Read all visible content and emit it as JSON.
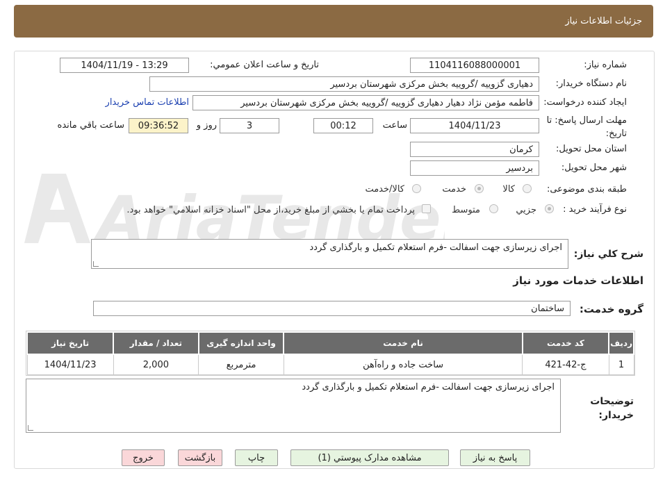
{
  "header": {
    "title": "جزئیات اطلاعات نیاز"
  },
  "watermark": {
    "text": "AriaTender.neT"
  },
  "fields": {
    "need_number_label": "شماره نیاز:",
    "need_number": "1104116088000001",
    "announce_label": "تاریخ و ساعت اعلان عمومي:",
    "announce_value": "1404/11/19 - 13:29",
    "buyer_org_label": "نام دستگاه خريدار:",
    "buyer_org": "دهیاری گزوییه /گروییه بخش مرکزی شهرستان بردسیر",
    "requester_label": "ايجاد کننده درخواست:",
    "requester": "فاطمه مؤمن نژاد دهیار دهیاری گزوییه /گروییه بخش مرکزی شهرستان بردسیر",
    "contact_link": "اطلاعات تماس خريدار",
    "deadline_label": "مهلت ارسال پاسخ: تا تاريخ:",
    "deadline_date": "1404/11/23",
    "time_label": "ساعت",
    "deadline_time": "00:12",
    "days": "3",
    "days_label": "روز و",
    "remaining": "09:36:52",
    "remaining_label": "ساعت باقي مانده",
    "province_label": "استان محل تحويل:",
    "province": "کرمان",
    "city_label": "شهر محل تحويل:",
    "city": "بردسیر",
    "category_label": "طبقه بندی موضوعی:",
    "category_options": [
      "کالا",
      "خدمت",
      "کالا/خدمت"
    ],
    "category_selected": "خدمت",
    "process_label": "نوع فرآيند خريد :",
    "process_options": [
      "جزيي",
      "متوسط"
    ],
    "process_selected": "جزيي",
    "payment_note": "پرداخت تمام يا بخشي از مبلغ خريد،از محل \"اسناد خزانه اسلامي\" خواهد بود."
  },
  "summary": {
    "label": "شرح کلي نياز:",
    "text": "اجرای زیرسازی  جهت اسفالت -فرم استعلام تکمیل و بارگذاری گردد"
  },
  "services_section": {
    "title": "اطلاعات خدمات مورد نياز"
  },
  "service_group": {
    "label": "گروه خدمت:",
    "value": "ساختمان"
  },
  "table": {
    "headers": [
      "رديف",
      "کد خدمت",
      "نام خدمت",
      "واحد اندازه گيری",
      "تعداد / مقدار",
      "تاريخ نياز"
    ],
    "rows": [
      [
        "1",
        "ج-42-421",
        "ساخت جاده و راه‌آهن",
        "مترمربع",
        "2,000",
        "1404/11/23"
      ]
    ]
  },
  "buyer_notes": {
    "label": "توضيحات خريدار:",
    "text": "اجرای زیرسازی  جهت اسفالت -فرم استعلام تکمیل و بارگذاری گردد"
  },
  "buttons": {
    "reply": "پاسخ به نياز",
    "attachments": "مشاهده مدارک پيوستي (1)",
    "print": "چاپ",
    "back": "بازگشت",
    "exit": "خروج"
  }
}
